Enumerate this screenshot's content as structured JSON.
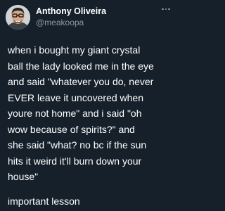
{
  "author": {
    "display_name": "Anthony Oliveira",
    "handle": "@meakoopa",
    "avatar_icon": "user-avatar-photo"
  },
  "more_icon": "ellipsis-icon",
  "tweet": {
    "lines": [
      "when i bought my giant crystal",
      "ball the lady looked me in the eye",
      "and said \"whatever you do, never",
      "EVER leave it uncovered when",
      "youre not home\" and i said \"oh",
      "wow because of spirits?\" and",
      "she said \"what? no bc if the sun",
      "hits it weird it'll burn down your",
      "house\""
    ],
    "closing_line": "important lesson"
  },
  "colors": {
    "background": "#15202b",
    "text": "#ffffff",
    "secondary_text": "#8b98a5"
  }
}
